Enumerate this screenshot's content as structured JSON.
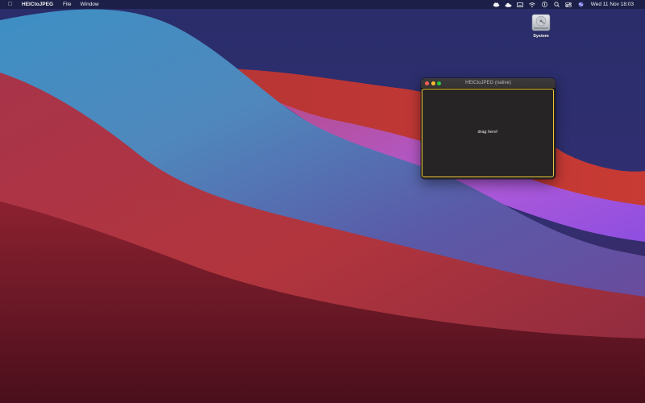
{
  "menubar": {
    "app_name": "HEICtoJPEG",
    "menus": [
      "File",
      "Window"
    ],
    "status_icons": [
      "weather-cloud-icon",
      "cloud-icon",
      "keyboard-icon",
      "wifi-icon",
      "accessibility-icon",
      "search-icon",
      "control-center-icon",
      "siri-icon"
    ],
    "datetime": "Wed 11 Nov  18:03"
  },
  "desktop": {
    "icons": [
      {
        "label": "System",
        "icon": "hard-drive-icon"
      }
    ]
  },
  "window": {
    "title": "HEICtoJPEG (native)",
    "dropzone_text": "drag here!",
    "accent_color": "#f0c53a"
  },
  "colors": {
    "close": "#fe5f57",
    "minimize": "#febc2e",
    "maximize": "#28c840",
    "window_bg": "#262424"
  }
}
